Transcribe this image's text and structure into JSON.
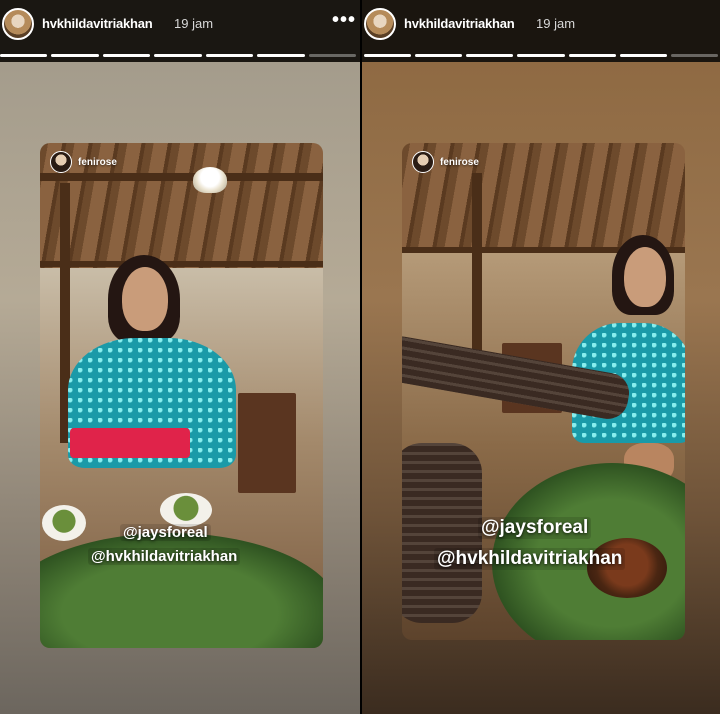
{
  "stories": [
    {
      "username": "hvkhildavitriakhan",
      "time": "19 jam",
      "more_icon": "more-horizontal-icon",
      "repost": {
        "username": "fenirose",
        "mentions": [
          "@jaysforeal",
          "@hvkhildavitriakhan"
        ]
      }
    },
    {
      "username": "hvkhildavitriakhan",
      "time": "19 jam",
      "more_icon": "more-horizontal-icon",
      "repost": {
        "username": "fenirose",
        "mentions": [
          "@jaysforeal",
          "@hvkhildavitriakhan"
        ]
      }
    }
  ],
  "colors": {
    "mention_text": "#ffffff",
    "kebaya": "#1a9aa8",
    "sash": "#e0234a",
    "progress_active": "#ffffff"
  }
}
